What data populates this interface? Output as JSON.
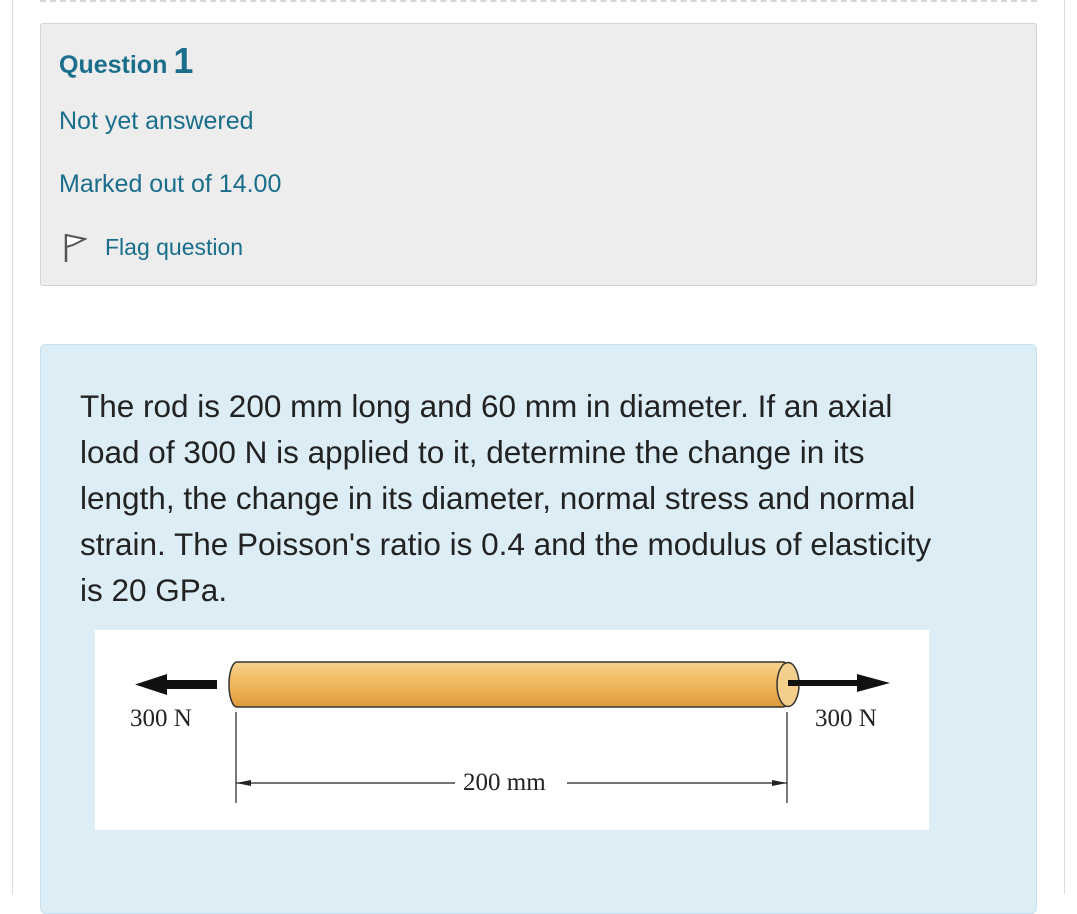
{
  "question": {
    "prefix": "Question",
    "number": "1",
    "state": "Not yet answered",
    "grade": "Marked out of 14.00",
    "flag_label": "Flag question"
  },
  "content": {
    "text": "The rod is 200 mm long and 60 mm in diameter. If an axial load of 300 N is applied to it, determine the change in its length, the change in its diameter, normal stress and normal strain. The Poisson's ratio is 0.4 and the modulus of elasticity is 20 GPa."
  },
  "figure": {
    "left_force": "300 N",
    "right_force": "300 N",
    "length": "200 mm"
  },
  "colors": {
    "link": "#1a6e8c",
    "info_bg": "#ededed",
    "content_bg": "#dcedf5",
    "rod": "#f0b85a"
  }
}
